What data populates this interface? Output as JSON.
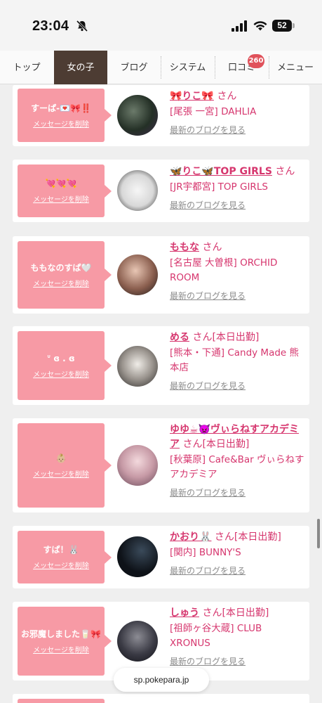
{
  "status": {
    "time": "23:04",
    "battery": "52"
  },
  "nav": {
    "tabs": [
      "トップ",
      "女の子",
      "ブログ",
      "システム",
      "口コミ",
      "メニュー"
    ],
    "active": 1,
    "badge": "260"
  },
  "delete_label": "メッセージを削除",
  "blog_label": "最新のブログを見る",
  "cards": [
    {
      "message": "すーぱ-💌🎀‼️",
      "name": "🎀りこ🎀",
      "suffix": "さん",
      "shop": "[尾張 一宮] DAHLIA"
    },
    {
      "message": "💘💘💘",
      "name": "🦋りこ🦋TOP GIRLS",
      "suffix": "さん",
      "shop": "[JR宇都宮] TOP GIRLS"
    },
    {
      "message": "ももなのすぱ🤍",
      "name": "ももな",
      "suffix": "さん",
      "shop": "[名古屋 大曽根] ORCHID ROOM"
    },
    {
      "message": "ᐡ ɞ . ɞ",
      "name": "める",
      "suffix": "さん[本日出勤]",
      "shop": "[熊本・下通] Candy Made 熊本店"
    },
    {
      "message": "👶🏼",
      "name": "ゆゆ☕👿ヴぃらねすアカデミア",
      "suffix": "さん[本日出勤]",
      "shop": "[秋葉原] Cafe&Bar ヴぃらねすアカデミア"
    },
    {
      "message": "すぱ！🐰",
      "name": "かおり🐰",
      "suffix": "さん[本日出勤]",
      "shop": "[関内] BUNNY'S"
    },
    {
      "message": "お邪魔しました🥛🎀",
      "name": "しゅう",
      "suffix": "さん[本日出勤]",
      "shop": "[祖師ヶ谷大蔵] CLUB XRONUS"
    }
  ],
  "url": "sp.pokepara.jp"
}
